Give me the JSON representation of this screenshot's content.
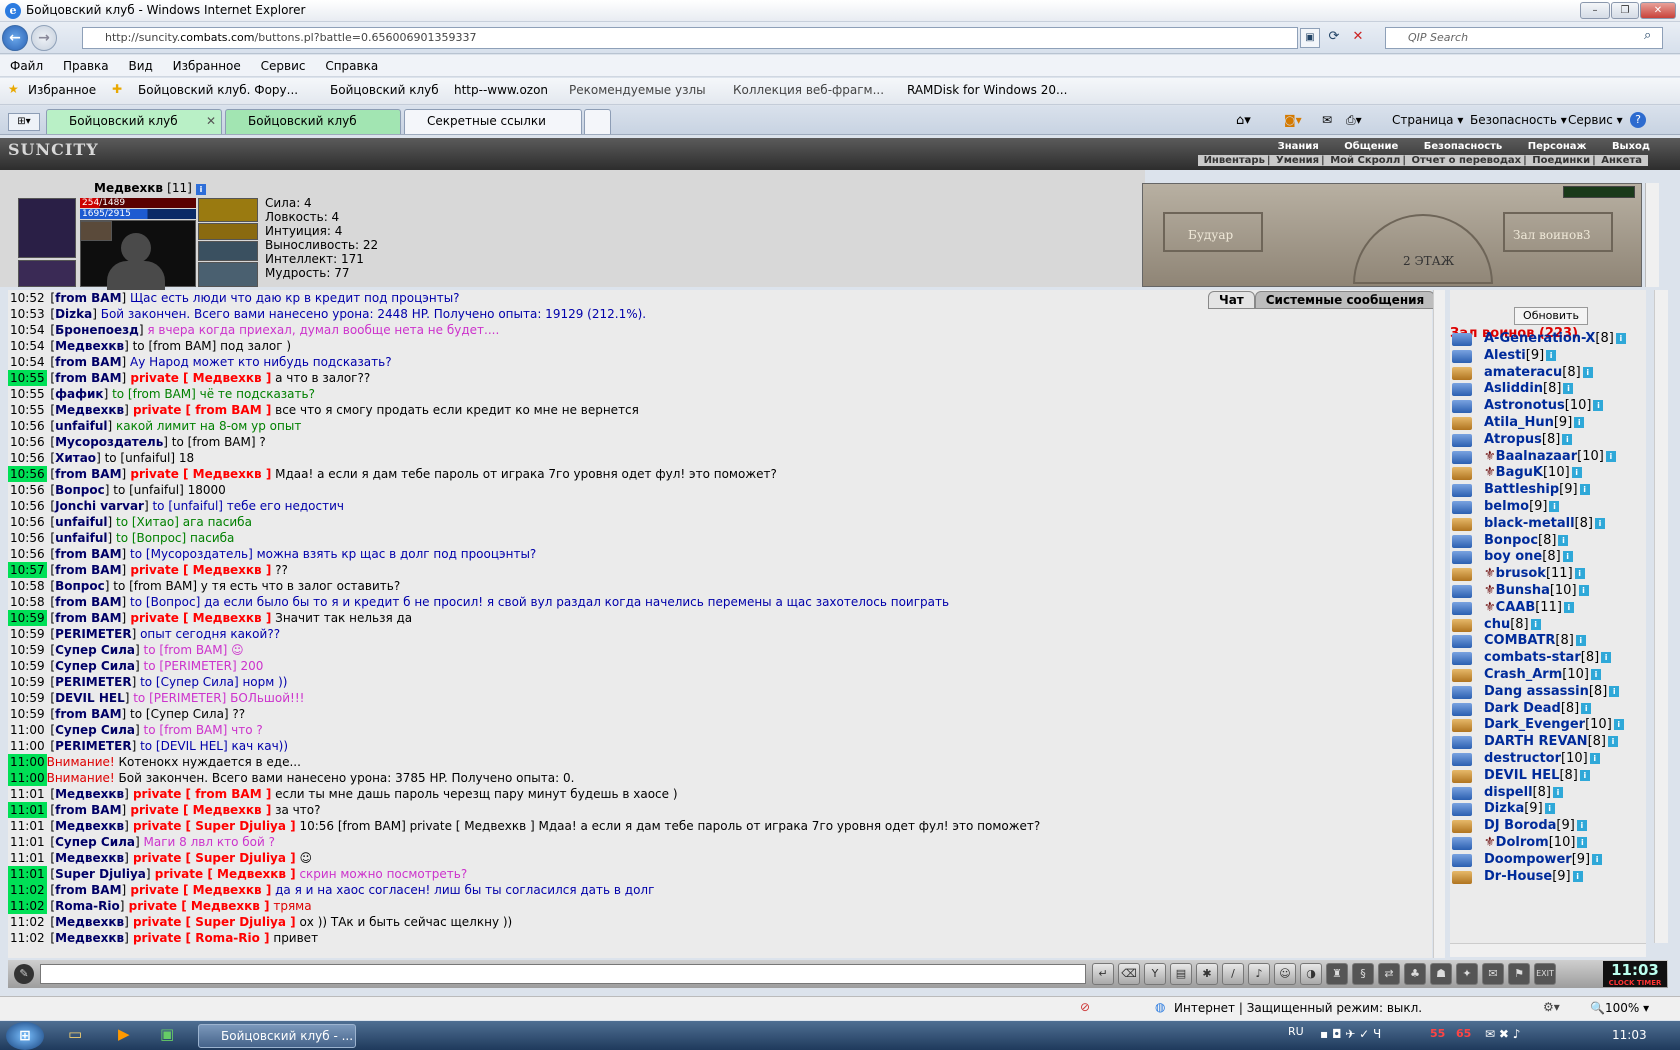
{
  "window": {
    "title": "Бойцовский клуб - Windows Internet Explorer"
  },
  "address": {
    "url_prefix": "http://suncity.",
    "url_host": "combats.com",
    "url_rest": "/buttons.pl?battle=0.656006901359337",
    "search_placeholder": "QIP Search"
  },
  "menu": [
    "Файл",
    "Правка",
    "Вид",
    "Избранное",
    "Сервис",
    "Справка"
  ],
  "favorites": {
    "label": "Избранное",
    "items": [
      "Бойцовский клуб. Фору...",
      "Бойцовский клуб",
      "http--www.ozon",
      "Рекомендуемые узлы",
      "Коллекция веб-фрагм...",
      "RAMDisk for Windows 20..."
    ]
  },
  "tabs": [
    "Бойцовский клуб",
    "Бойцовский клуб",
    "Секретные ссылки"
  ],
  "tab_tools": [
    "Страница",
    "Безопасность",
    "Сервис"
  ],
  "game": {
    "logo": "SUNCITY",
    "menu_top": [
      "Знания",
      "Общение",
      "Безопасность",
      "Персонаж",
      "Выход"
    ],
    "menu_bottom": [
      "Инвентарь",
      "Умения",
      "Мой Скролл",
      "Отчет о переводах",
      "Поединки",
      "Анкета"
    ]
  },
  "character": {
    "name": "Медвехкв",
    "level": "[11]",
    "hp": "254/1489",
    "mana": "1695/2915",
    "stats": [
      "Сила: 4",
      "Ловкость: 4",
      "Интуиция: 4",
      "Выносливость: 22",
      "Интеллект: 171",
      "Мудрость: 77"
    ],
    "hp_fraction": 0.17,
    "mana_fraction": 0.58
  },
  "location": {
    "left_room": "Будуар",
    "right_room": "Зал воинов3",
    "floor": "2 ЭТАЖ"
  },
  "chat_tabs": [
    "Чат",
    "Системные сообщения"
  ],
  "chat": [
    {
      "t": "10:52",
      "hi": false,
      "parts": [
        [
          "n",
          "from BAM"
        ],
        [
          "b",
          " Щас есть люди что даю кр в кредит под процэнты?"
        ]
      ]
    },
    {
      "t": "10:53",
      "hi": false,
      "parts": [
        [
          "n",
          "Dizka"
        ],
        [
          "b",
          " Бой закончен. Всего вами нанесено урона: 2448 HP. Получено опыта: 19129 (212.1%)."
        ]
      ]
    },
    {
      "t": "10:54",
      "hi": false,
      "parts": [
        [
          "n",
          "Бронепоезд"
        ],
        [
          "m",
          " я вчера когда приехал, думал вообще нета не будет...."
        ]
      ]
    },
    {
      "t": "10:54",
      "hi": false,
      "parts": [
        [
          "n",
          "Медвехкв"
        ],
        [
          "d",
          " to [from BAM] под залог )"
        ]
      ]
    },
    {
      "t": "10:54",
      "hi": false,
      "parts": [
        [
          "n",
          "from BAM"
        ],
        [
          "b",
          " Ау Народ может кто нибудь подсказать?"
        ]
      ]
    },
    {
      "t": "10:55",
      "hi": true,
      "parts": [
        [
          "n",
          "from BAM"
        ],
        [
          "p",
          " private [ Медвехкв ]"
        ],
        [
          "d",
          " а что в залог??"
        ]
      ]
    },
    {
      "t": "10:55",
      "hi": false,
      "parts": [
        [
          "n",
          "фафик"
        ],
        [
          "g",
          " to [from BAM] чё те подсказать?"
        ]
      ]
    },
    {
      "t": "10:55",
      "hi": false,
      "parts": [
        [
          "n",
          "Медвехкв"
        ],
        [
          "p",
          " private [ from BAM ]"
        ],
        [
          "d",
          " все что я смогу продать если кредит ко мне не вернется"
        ]
      ]
    },
    {
      "t": "10:56",
      "hi": false,
      "parts": [
        [
          "n",
          "unfaiful"
        ],
        [
          "g",
          " какой лимит на 8-ом ур опыт"
        ]
      ]
    },
    {
      "t": "10:56",
      "hi": false,
      "parts": [
        [
          "n",
          "Мусороздатель"
        ],
        [
          "d",
          " to [from BAM] ?"
        ]
      ]
    },
    {
      "t": "10:56",
      "hi": false,
      "parts": [
        [
          "n",
          "Хитао"
        ],
        [
          "d",
          " to [unfaiful] 18"
        ]
      ]
    },
    {
      "t": "10:56",
      "hi": true,
      "parts": [
        [
          "n",
          "from BAM"
        ],
        [
          "p",
          " private [ Медвехкв ]"
        ],
        [
          "d",
          " Мдаа! а если я дам тебе пароль от играка 7го уровня одет фул! это поможет?"
        ]
      ]
    },
    {
      "t": "10:56",
      "hi": false,
      "parts": [
        [
          "n",
          "Вопрос"
        ],
        [
          "d",
          " to [unfaiful] 18000"
        ]
      ]
    },
    {
      "t": "10:56",
      "hi": false,
      "parts": [
        [
          "n",
          "Jonchi varvar"
        ],
        [
          "b",
          " to [unfaiful] тебе его недостич"
        ]
      ]
    },
    {
      "t": "10:56",
      "hi": false,
      "parts": [
        [
          "n",
          "unfaiful"
        ],
        [
          "g",
          " to [Хитао] ага пасиба"
        ]
      ]
    },
    {
      "t": "10:56",
      "hi": false,
      "parts": [
        [
          "n",
          "unfaiful"
        ],
        [
          "g",
          " to [Вопрос] пасиба"
        ]
      ]
    },
    {
      "t": "10:56",
      "hi": false,
      "parts": [
        [
          "n",
          "from BAM"
        ],
        [
          "b",
          " to [Мусороздатель] можна взять кр щас в долг под прооцэнты?"
        ]
      ]
    },
    {
      "t": "10:57",
      "hi": true,
      "parts": [
        [
          "n",
          "from BAM"
        ],
        [
          "p",
          " private [ Медвехкв ]"
        ],
        [
          "d",
          " ??"
        ]
      ]
    },
    {
      "t": "10:58",
      "hi": false,
      "parts": [
        [
          "n",
          "Вопрос"
        ],
        [
          "d",
          " to [from BAM] у тя есть что в залог оставить?"
        ]
      ]
    },
    {
      "t": "10:58",
      "hi": false,
      "parts": [
        [
          "n",
          "from BAM"
        ],
        [
          "b",
          " to [Вопрос] да если было бы то я и кредит б не просил! я свой вул раздал когда начелись перемены а щас захотелось поиграть"
        ]
      ]
    },
    {
      "t": "10:59",
      "hi": true,
      "parts": [
        [
          "n",
          "from BAM"
        ],
        [
          "p",
          " private [ Медвехкв ]"
        ],
        [
          "d",
          " Значит так нельзя да"
        ]
      ]
    },
    {
      "t": "10:59",
      "hi": false,
      "parts": [
        [
          "n",
          "PERIMETER"
        ],
        [
          "b",
          " опыт сегодня какой??"
        ]
      ]
    },
    {
      "t": "10:59",
      "hi": false,
      "parts": [
        [
          "n",
          "Супер Сила"
        ],
        [
          "m",
          " to [from BAM] ☺"
        ]
      ]
    },
    {
      "t": "10:59",
      "hi": false,
      "parts": [
        [
          "n",
          "Супер Сила"
        ],
        [
          "m",
          " to [PERIMETER] 200"
        ]
      ]
    },
    {
      "t": "10:59",
      "hi": false,
      "parts": [
        [
          "n",
          "PERIMETER"
        ],
        [
          "b",
          " to [Супер Сила] норм ))"
        ]
      ]
    },
    {
      "t": "10:59",
      "hi": false,
      "parts": [
        [
          "n",
          "DEVIL HEL"
        ],
        [
          "m",
          " to [PERIMETER] БОЛьшой!!!"
        ]
      ]
    },
    {
      "t": "10:59",
      "hi": false,
      "parts": [
        [
          "n",
          "from BAM"
        ],
        [
          "d",
          " to [Супер Сила] ??"
        ]
      ]
    },
    {
      "t": "11:00",
      "hi": false,
      "parts": [
        [
          "n",
          "Супер Сила"
        ],
        [
          "m",
          " to [from BAM] что ?"
        ]
      ]
    },
    {
      "t": "11:00",
      "hi": false,
      "parts": [
        [
          "n",
          "PERIMETER"
        ],
        [
          "b",
          " to [DEVIL HEL] кач кач))"
        ]
      ]
    },
    {
      "t": "11:00",
      "hi": true,
      "parts": [
        [
          "r",
          "Внимание!"
        ],
        [
          "d",
          " Котенокх нуждается в еде..."
        ]
      ]
    },
    {
      "t": "11:00",
      "hi": true,
      "parts": [
        [
          "r",
          "Внимание!"
        ],
        [
          "d",
          " Бой закончен. Всего вами нанесено урона: 3785 HP. Получено опыта: 0."
        ]
      ]
    },
    {
      "t": "11:01",
      "hi": false,
      "parts": [
        [
          "n",
          "Медвехкв"
        ],
        [
          "p",
          " private [ from BAM ]"
        ],
        [
          "d",
          " если ты мне дашь пароль черезщ пару минут будешь в хаосе )"
        ]
      ]
    },
    {
      "t": "11:01",
      "hi": true,
      "parts": [
        [
          "n",
          "from BAM"
        ],
        [
          "p",
          " private [ Медвехкв ]"
        ],
        [
          "d",
          " за что?"
        ]
      ]
    },
    {
      "t": "11:01",
      "hi": false,
      "parts": [
        [
          "n",
          "Медвехкв"
        ],
        [
          "p",
          " private [ Super Djuliya ]"
        ],
        [
          "d",
          " 10:56 [from BAM] private [ Медвехкв ] Мдаа! а если я дам тебе пароль от играка 7го уровня одет фул! это поможет?"
        ]
      ]
    },
    {
      "t": "11:01",
      "hi": false,
      "parts": [
        [
          "n",
          "Супер Сила"
        ],
        [
          "m",
          " Маги 8 лвл кто бой ?"
        ]
      ]
    },
    {
      "t": "11:01",
      "hi": false,
      "parts": [
        [
          "n",
          "Медвехкв"
        ],
        [
          "p",
          " private [ Super Djuliya ]"
        ],
        [
          "d",
          " ☺"
        ]
      ]
    },
    {
      "t": "11:01",
      "hi": true,
      "parts": [
        [
          "n",
          "Super Djuliya"
        ],
        [
          "p",
          " private [ Медвехкв ]"
        ],
        [
          "m",
          " скрин можно посмотреть?"
        ]
      ]
    },
    {
      "t": "11:02",
      "hi": true,
      "parts": [
        [
          "n",
          "from BAM"
        ],
        [
          "p",
          " private [ Медвехкв ]"
        ],
        [
          "b",
          " да я и на хаос согласен! лиш бы ты согласился дать в долг"
        ]
      ]
    },
    {
      "t": "11:02",
      "hi": true,
      "parts": [
        [
          "n",
          "Roma-Rio"
        ],
        [
          "p",
          " private [ Медвехкв ]"
        ],
        [
          "r",
          " тряма"
        ]
      ]
    },
    {
      "t": "11:02",
      "hi": false,
      "parts": [
        [
          "n",
          "Медвехкв"
        ],
        [
          "p",
          " private [ Super Djuliya ]"
        ],
        [
          "d",
          " ох )) ТАк и быть сейчас щелкну ))"
        ]
      ]
    },
    {
      "t": "11:02",
      "hi": false,
      "parts": [
        [
          "n",
          "Медвехкв"
        ],
        [
          "p",
          " private [ Roma-Rio ]"
        ],
        [
          "d",
          " привет"
        ]
      ]
    }
  ],
  "online": {
    "refresh_label": "Обновить",
    "room_title": "Зал воинов (223)",
    "users": [
      {
        "name": "A-Generation-X",
        "level": "[8]",
        "clan": false
      },
      {
        "name": "Alesti",
        "level": "[9]",
        "clan": false
      },
      {
        "name": "amateraсu",
        "level": "[8]",
        "clan": false
      },
      {
        "name": "Asliddin",
        "level": "[8]",
        "clan": false
      },
      {
        "name": "Astronotus",
        "level": "[10]",
        "clan": false
      },
      {
        "name": "Atila_Hun",
        "level": "[9]",
        "clan": false
      },
      {
        "name": "Atropus",
        "level": "[8]",
        "clan": false
      },
      {
        "name": "Baalnazaar",
        "level": "[10]",
        "clan": true
      },
      {
        "name": "BaguK",
        "level": "[10]",
        "clan": true
      },
      {
        "name": "Battleship",
        "level": "[9]",
        "clan": false
      },
      {
        "name": "belmo",
        "level": "[9]",
        "clan": false
      },
      {
        "name": "black-metall",
        "level": "[8]",
        "clan": false
      },
      {
        "name": "Bonpoc",
        "level": "[8]",
        "clan": false
      },
      {
        "name": "boy one",
        "level": "[8]",
        "clan": false
      },
      {
        "name": "brusok",
        "level": "[11]",
        "clan": true
      },
      {
        "name": "Bunsha",
        "level": "[10]",
        "clan": true
      },
      {
        "name": "CAAB",
        "level": "[11]",
        "clan": true
      },
      {
        "name": "chu",
        "level": "[8]",
        "clan": false
      },
      {
        "name": "COMBATR",
        "level": "[8]",
        "clan": false
      },
      {
        "name": "combats-star",
        "level": "[8]",
        "clan": false
      },
      {
        "name": "Crash_Arm",
        "level": "[10]",
        "clan": false
      },
      {
        "name": "Dang assassin",
        "level": "[8]",
        "clan": false
      },
      {
        "name": "Dark Dead",
        "level": "[8]",
        "clan": false
      },
      {
        "name": "Dark_Evenger",
        "level": "[10]",
        "clan": false
      },
      {
        "name": "DARTH REVAN",
        "level": "[8]",
        "clan": false
      },
      {
        "name": "destructor",
        "level": "[10]",
        "clan": false
      },
      {
        "name": "DEVIL HEL",
        "level": "[8]",
        "clan": false
      },
      {
        "name": "dispell",
        "level": "[8]",
        "clan": false
      },
      {
        "name": "Dizka",
        "level": "[9]",
        "clan": false
      },
      {
        "name": "DJ Boroda",
        "level": "[9]",
        "clan": false
      },
      {
        "name": "Dolrom",
        "level": "[10]",
        "clan": true
      },
      {
        "name": "Doompower",
        "level": "[9]",
        "clan": false
      },
      {
        "name": "Dr-House",
        "level": "[9]",
        "clan": false
      }
    ]
  },
  "clock": {
    "time": "11:03",
    "caption": "CLOCK TIMER"
  },
  "status": {
    "zone": "Интернет | Защищенный режим: выкл.",
    "zoom": "100%"
  },
  "taskbar": {
    "item": "Бойцовский клуб - ...",
    "lang": "RU",
    "tray_a": "55",
    "tray_b": "65",
    "time": "11:03"
  }
}
